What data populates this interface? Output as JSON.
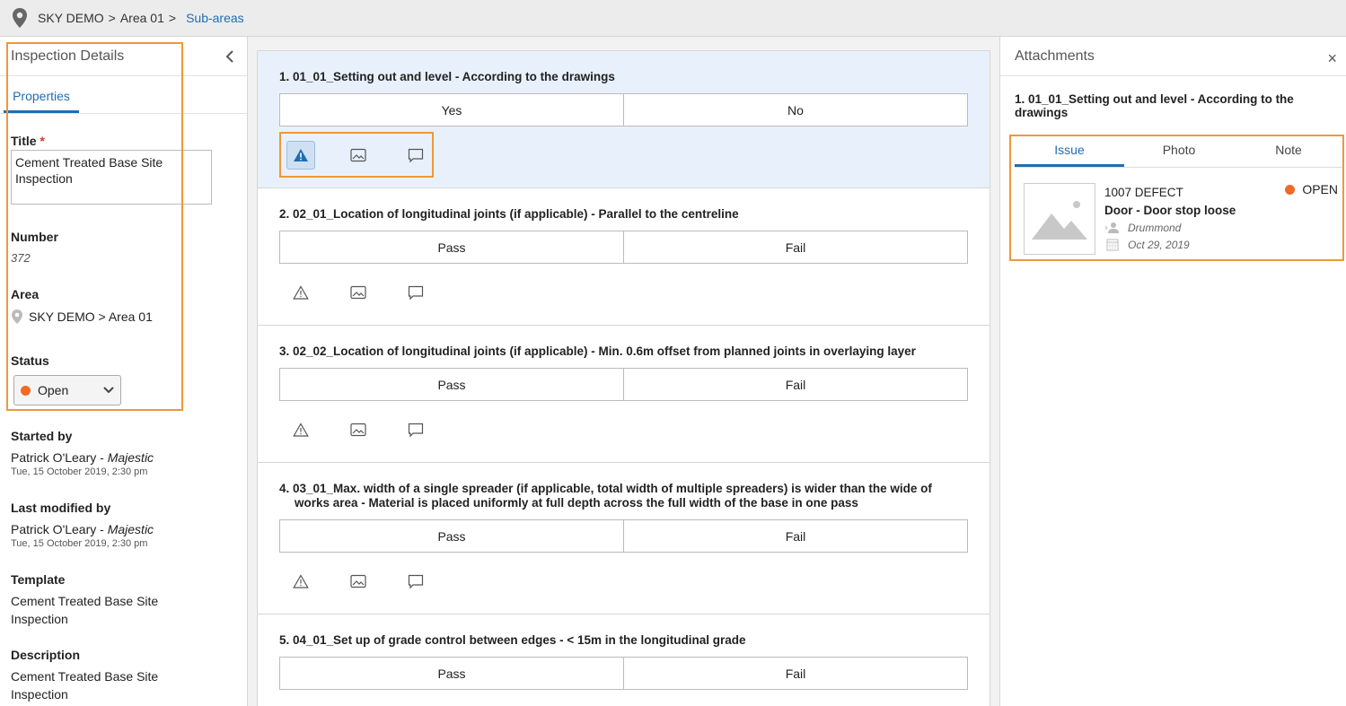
{
  "breadcrumb": {
    "project": "SKY DEMO",
    "sep1": ">",
    "area": "Area 01",
    "sep2": ">",
    "link": "Sub-areas"
  },
  "left": {
    "title": "Inspection Details",
    "tab": "Properties",
    "title_label": "Title",
    "required_mark": "*",
    "title_value": "Cement Treated Base Site Inspection",
    "number_label": "Number",
    "number_value": "372",
    "area_label": "Area",
    "area_value": "SKY DEMO > Area 01",
    "status_label": "Status",
    "status_value": "Open",
    "started_label": "Started by",
    "started_name": "Patrick O'Leary - ",
    "started_company": "Majestic",
    "started_date": "Tue, 15 October 2019, 2:30 pm",
    "modified_label": "Last modified by",
    "modified_name": "Patrick O'Leary - ",
    "modified_company": "Majestic",
    "modified_date": "Tue, 15 October 2019, 2:30 pm",
    "template_label": "Template",
    "template_value_1": "Cement Treated Base Site",
    "template_value_2": "Inspection",
    "description_label": "Description",
    "description_value_1": "Cement Treated Base Site",
    "description_value_2": "Inspection"
  },
  "questions": [
    {
      "title": "1. 01_01_Setting out and level - According to the drawings",
      "options": [
        "Yes",
        "No"
      ]
    },
    {
      "title": "2. 02_01_Location of longitudinal joints (if applicable) - Parallel to the centreline",
      "options": [
        "Pass",
        "Fail"
      ]
    },
    {
      "title": "3. 02_02_Location of longitudinal joints (if applicable) - Min. 0.6m offset from planned joints in overlaying layer",
      "options": [
        "Pass",
        "Fail"
      ]
    },
    {
      "title_1": "4. 03_01_Max. width of a single spreader (if applicable, total width of multiple spreaders) is wider than the wide of",
      "title_2": "works area - Material is placed uniformly at full depth across the full width of the base in one pass",
      "options": [
        "Pass",
        "Fail"
      ]
    },
    {
      "title": "5. 04_01_Set up of grade control between edges - < 15m in the longitudinal grade",
      "options": [
        "Pass",
        "Fail"
      ]
    }
  ],
  "right": {
    "title": "Attachments",
    "close": "×",
    "question_1": "1. 01_01_Setting out and level - According to the",
    "question_2": "drawings",
    "tabs": [
      "Issue",
      "Photo",
      "Note"
    ],
    "card": {
      "code": "1007 DEFECT",
      "title": "Door - Door stop loose",
      "assignee": "Drummond",
      "date": "Oct 29, 2019",
      "status": "OPEN"
    }
  },
  "colors": {
    "accent": "#1f6db5",
    "highlight": "#f0973a",
    "status_open": "#f06a27"
  }
}
